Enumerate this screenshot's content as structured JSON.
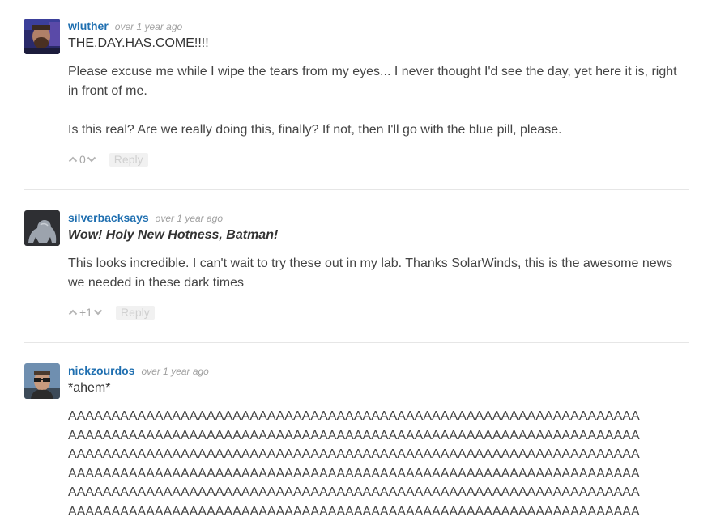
{
  "comments": [
    {
      "author": "wluther",
      "time": "over 1 year ago",
      "title": "THE.DAY.HAS.COME!!!!",
      "paragraphs": [
        "Please excuse me while I wipe the tears from my eyes... I never thought I'd see the day, yet here it is, right in front of me.",
        "Is this real? Are we really doing this, finally? If not, then I'll go with the blue pill, please."
      ],
      "score": "0",
      "reply_label": "Reply"
    },
    {
      "author": "silverbacksays",
      "time": "over 1 year ago",
      "title": "Wow! Holy New Hotness, Batman!",
      "paragraphs": [
        "This looks incredible. I can't wait to try these out in my lab. Thanks SolarWinds, this is the awesome news we needed in these dark times"
      ],
      "score": "+1",
      "reply_label": "Reply"
    },
    {
      "author": "nickzourdos",
      "time": "over 1 year ago",
      "title": "*ahem*",
      "lines": [
        "AAAAAAAAAAAAAAAAAAAAAAAAAAAAAAAAAAAAAAAAAAAAAAAAAAAAAAAAAAAAAAAAAA",
        "AAAAAAAAAAAAAAAAAAAAAAAAAAAAAAAAAAAAAAAAAAAAAAAAAAAAAAAAAAAAAAAAAA",
        "AAAAAAAAAAAAAAAAAAAAAAAAAAAAAAAAAAAAAAAAAAAAAAAAAAAAAAAAAAAAAAAAAA",
        "AAAAAAAAAAAAAAAAAAAAAAAAAAAAAAAAAAAAAAAAAAAAAAAAAAAAAAAAAAAAAAAAAA",
        "AAAAAAAAAAAAAAAAAAAAAAAAAAAAAAAAAAAAAAAAAAAAAAAAAAAAAAAAAAAAAAAAAA",
        "AAAAAAAAAAAAAAAAAAAAAAAAAAAAAAAAAAAAAAAAAAAAAAAAAAAAAAAAAAAAAAAAAA"
      ]
    }
  ],
  "icons": {
    "upvote": "chevron-up-icon",
    "downvote": "chevron-down-icon"
  },
  "colors": {
    "author_link": "#1f6fb0",
    "timestamp": "#a0a0a0",
    "divider": "#e6e6e6"
  }
}
